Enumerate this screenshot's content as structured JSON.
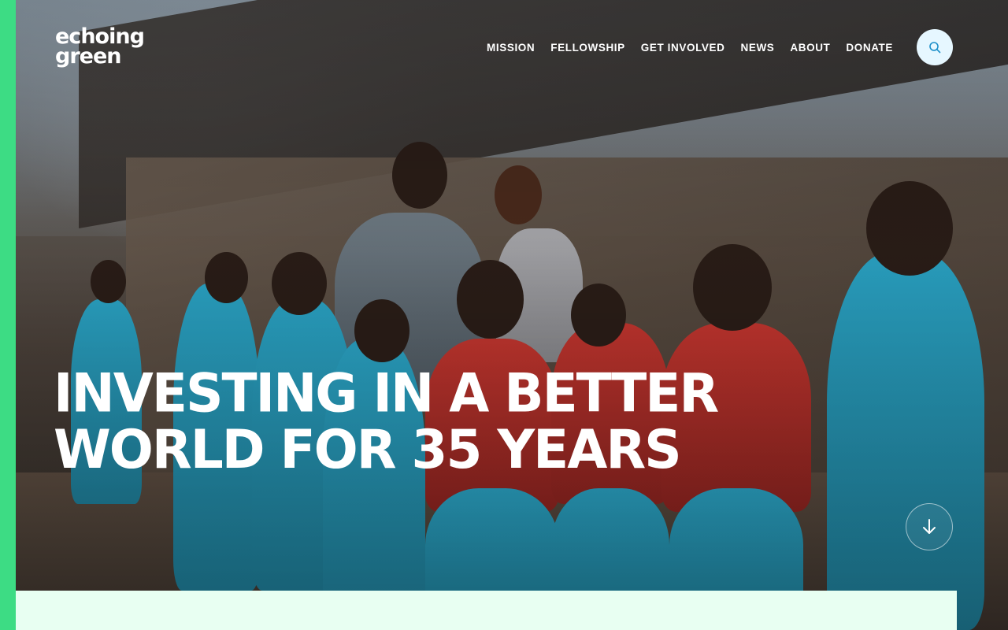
{
  "brand": {
    "logo_line1": "echoing",
    "logo_line2": "green"
  },
  "nav": {
    "items": [
      {
        "label": "MISSION"
      },
      {
        "label": "FELLOWSHIP"
      },
      {
        "label": "GET INVOLVED"
      },
      {
        "label": "NEWS"
      },
      {
        "label": "ABOUT"
      },
      {
        "label": "DONATE"
      }
    ],
    "search_icon": "search-icon"
  },
  "hero": {
    "headline_line1": "INVESTING IN A BETTER",
    "headline_line2": "WORLD FOR 35 YEARS",
    "scroll_icon": "arrow-down-icon"
  },
  "colors": {
    "accent_green": "#3ddc84",
    "search_button_bg": "#e6f7ff",
    "panel_bg": "#e8fff2",
    "nav_text": "#ffffff"
  }
}
